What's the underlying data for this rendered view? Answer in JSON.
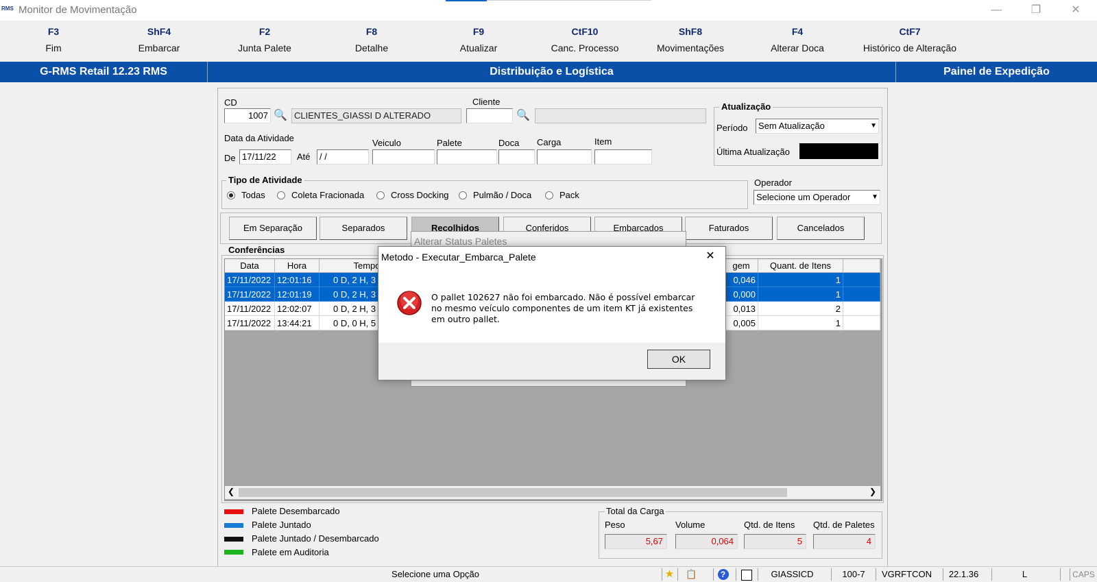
{
  "window": {
    "logo": "RMS",
    "title": "Monitor de Movimentação"
  },
  "fkeys": [
    {
      "key": "F3",
      "label": "Fim"
    },
    {
      "key": "ShF4",
      "label": "Embarcar"
    },
    {
      "key": "F2",
      "label": "Junta Palete"
    },
    {
      "key": "F8",
      "label": "Detalhe"
    },
    {
      "key": "F9",
      "label": "Atualizar"
    },
    {
      "key": "CtF10",
      "label": "Canc. Processo"
    },
    {
      "key": "ShF8",
      "label": "Movimentações"
    },
    {
      "key": "F4",
      "label": "Alterar Doca"
    },
    {
      "key": "CtF7",
      "label": "Histórico de Alteração"
    }
  ],
  "header": {
    "left": "G-RMS Retail 12.23 RMS",
    "center": "Distribuição e Logística",
    "right": "Painel de Expedição"
  },
  "filters": {
    "cd_label": "CD",
    "cd_value": "1007",
    "cd_name": "CLIENTES_GIASSI D ALTERADO",
    "cliente_label": "Cliente",
    "cliente_value": "",
    "cliente_name": "",
    "data_atividade_label": "Data da Atividade",
    "de_label": "De",
    "de_value": "17/11/22",
    "ate_label": "Até",
    "ate_value": " / /",
    "veiculo_label": "Veiculo",
    "palete_label": "Palete",
    "doca_label": "Doca",
    "carga_label": "Carga",
    "item_label": "Item"
  },
  "atualizacao": {
    "title": "Atualização",
    "periodo_label": "Período",
    "periodo_value": "Sem Atualização",
    "ultima_label": "Última Atualização"
  },
  "tipo_atividade": {
    "title": "Tipo de Atividade",
    "options": [
      "Todas",
      "Coleta Fracionada",
      "Cross Docking",
      "Pulmão / Doca",
      "Pack"
    ],
    "selected": "Todas"
  },
  "operador": {
    "label": "Operador",
    "value": "Selecione um Operador"
  },
  "tabs": [
    "Em Separação",
    "Separados",
    "Recolhidos",
    "Conferidos",
    "Embarcados",
    "Faturados",
    "Cancelados"
  ],
  "conferencias": {
    "title": "Conferências",
    "columns": [
      "Data",
      "Hora",
      "Tempo",
      "gem",
      "Quant. de Itens"
    ],
    "rows": [
      {
        "data": "17/11/2022",
        "hora": "12:01:16",
        "tempo": "0 D, 2 H, 3",
        "gem": "0,046",
        "qtd": "1",
        "selected": true
      },
      {
        "data": "17/11/2022",
        "hora": "12:01:19",
        "tempo": "0 D, 2 H, 3",
        "gem": "0,000",
        "qtd": "1",
        "selected": true
      },
      {
        "data": "17/11/2022",
        "hora": "12:02:07",
        "tempo": "0 D, 2 H, 3",
        "gem": "0,013",
        "qtd": "2",
        "selected": false
      },
      {
        "data": "17/11/2022",
        "hora": "13:44:21",
        "tempo": "0 D, 0 H, 5",
        "gem": "0,005",
        "qtd": "1",
        "selected": false
      }
    ]
  },
  "legend": [
    {
      "label": "Palete Desembarcado",
      "color": "#e81010"
    },
    {
      "label": "Palete Juntado",
      "color": "#1a7ad8"
    },
    {
      "label": "Palete Juntado / Desembarcado",
      "color": "#111111"
    },
    {
      "label": "Palete em Auditoria",
      "color": "#19b41e"
    }
  ],
  "totais": {
    "title": "Total da Carga",
    "peso_label": "Peso",
    "peso": "5,67",
    "volume_label": "Volume",
    "volume": "0,064",
    "itens_label": "Qtd. de Itens",
    "itens": "5",
    "paletes_label": "Qtd. de Paletes",
    "paletes": "4"
  },
  "background_dialog": {
    "title": "Alterar Status Paletes"
  },
  "dialog": {
    "title": "Metodo - Executar_Embarca_Palete",
    "line1": "O pallet 102627 não foi embarcado. Não é possível embarcar",
    "line2": "no mesmo veículo componentes de um item KT já existentes",
    "line3": "em outro pallet.",
    "ok": "OK",
    "icon": "error-icon"
  },
  "statusbar": {
    "message": "Selecione uma Opção",
    "user": "GIASSICD",
    "code": "100-7",
    "server": "VGRFTCON",
    "version": "22.1.36",
    "mode": "L",
    "caps": "CAPS"
  },
  "colors": {
    "header_blue": "#0a4fa8",
    "selection_blue": "#0066cc",
    "total_red": "#e00000"
  }
}
